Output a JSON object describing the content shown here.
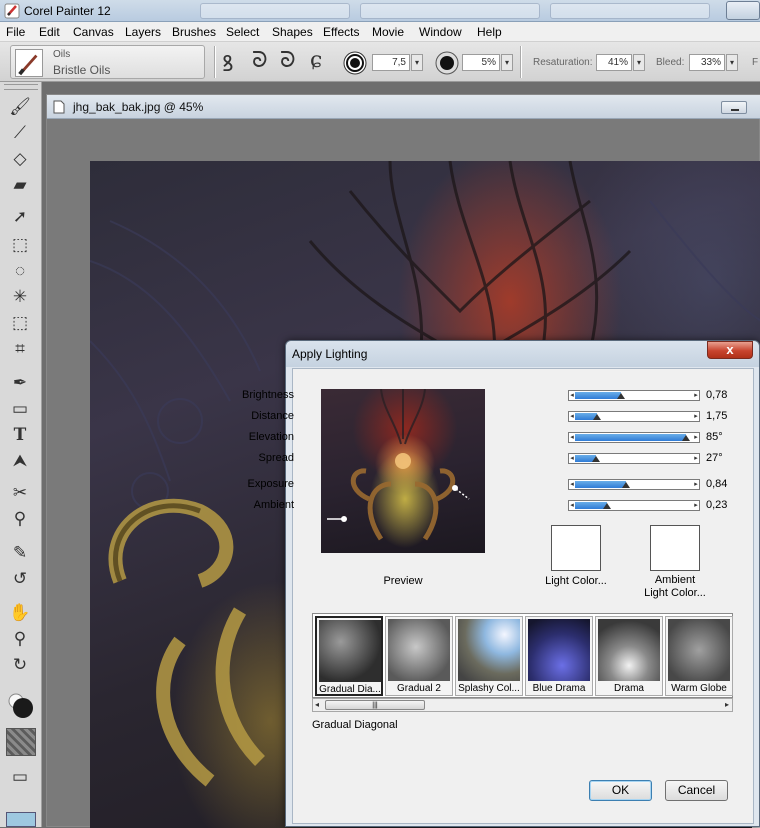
{
  "window": {
    "title": "Corel Painter 12"
  },
  "menu": [
    "File",
    "Edit",
    "Canvas",
    "Layers",
    "Brushes",
    "Select",
    "Shapes",
    "Effects",
    "Movie",
    "Window",
    "Help"
  ],
  "property_bar": {
    "brush_category": "Oils",
    "brush_variant": "Bristle Oils",
    "size_value": "7,5",
    "opacity_value": "5%",
    "resaturation_label": "Resaturation:",
    "resaturation_value": "41%",
    "bleed_label": "Bleed:",
    "bleed_value": "33%",
    "overflow_label": "F"
  },
  "document": {
    "title": "jhg_bak_bak.jpg @ 45%"
  },
  "dialog": {
    "title": "Apply Lighting",
    "close_label": "x",
    "preview_label": "Preview",
    "sliders": [
      {
        "label": "Brightness",
        "value": "0,78",
        "fraction": 0.39
      },
      {
        "label": "Distance",
        "value": "1,75",
        "fraction": 0.19
      },
      {
        "label": "Elevation",
        "value": "85°",
        "fraction": 0.94
      },
      {
        "label": "Spread",
        "value": "27°",
        "fraction": 0.18
      },
      {
        "label": "Exposure",
        "value": "0,84",
        "fraction": 0.43
      },
      {
        "label": "Ambient",
        "value": "0,23",
        "fraction": 0.27
      }
    ],
    "light_color_label": "Light Color...",
    "ambient_color_label_1": "Ambient",
    "ambient_color_label_2": "Light Color...",
    "library": [
      {
        "name": "Gradual Dia...",
        "selected": true
      },
      {
        "name": "Gradual 2",
        "selected": false
      },
      {
        "name": "Splashy Col...",
        "selected": false
      },
      {
        "name": "Blue Drama",
        "selected": false
      },
      {
        "name": "Drama",
        "selected": false
      },
      {
        "name": "Warm Globe",
        "selected": false
      }
    ],
    "selected_name": "Gradual Diagonal",
    "ok_label": "OK",
    "cancel_label": "Cancel"
  },
  "colors": {
    "accent": "#2f7bd6",
    "close": "#c8442e"
  }
}
